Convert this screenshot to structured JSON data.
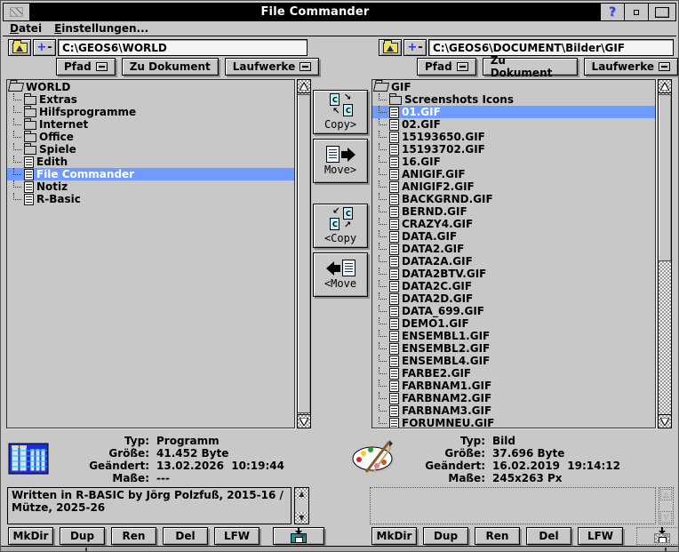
{
  "window": {
    "title": "File Commander",
    "help_label": "?"
  },
  "menu": {
    "items": [
      {
        "label": "Datei"
      },
      {
        "label": "Einstellungen..."
      }
    ]
  },
  "paths": {
    "left": "C:\\GEOS6\\WORLD",
    "right": "C:\\GEOS6\\DOCUMENT\\Bilder\\GIF"
  },
  "path_tools": {
    "plus": "+",
    "minus": "-"
  },
  "nav_buttons": {
    "pfad": "Pfad",
    "zu_dokument": "Zu Dokument",
    "laufwerke": "Laufwerke"
  },
  "transfer": {
    "copy_right": "Copy>",
    "move_right": "Move>",
    "copy_left": "<Copy",
    "move_left": "<Move"
  },
  "left_panel": {
    "root": "WORLD",
    "items": [
      {
        "label": "Extras",
        "type": "folder"
      },
      {
        "label": "Hilfsprogramme",
        "type": "folder"
      },
      {
        "label": "Internet",
        "type": "folder"
      },
      {
        "label": "Office",
        "type": "folder"
      },
      {
        "label": "Spiele",
        "type": "folder"
      },
      {
        "label": "Edith",
        "type": "file"
      },
      {
        "label": "File Commander",
        "type": "file",
        "selected": true
      },
      {
        "label": "Notiz",
        "type": "file"
      },
      {
        "label": "R-Basic",
        "type": "file"
      }
    ]
  },
  "right_panel": {
    "root": "GIF",
    "items": [
      {
        "label": "Screenshots Icons",
        "type": "folder"
      },
      {
        "label": "01.GIF",
        "type": "file",
        "selected": true
      },
      {
        "label": "02.GIF",
        "type": "file"
      },
      {
        "label": "15193650.GIF",
        "type": "file"
      },
      {
        "label": "15193702.GIF",
        "type": "file"
      },
      {
        "label": "16.GIF",
        "type": "file"
      },
      {
        "label": "ANIGIF.GIF",
        "type": "file"
      },
      {
        "label": "ANIGIF2.GIF",
        "type": "file"
      },
      {
        "label": "BACKGRND.GIF",
        "type": "file"
      },
      {
        "label": "BERND.GIF",
        "type": "file"
      },
      {
        "label": "CRAZY4.GIF",
        "type": "file"
      },
      {
        "label": "DATA.GIF",
        "type": "file"
      },
      {
        "label": "DATA2.GIF",
        "type": "file"
      },
      {
        "label": "DATA2A.GIF",
        "type": "file"
      },
      {
        "label": "DATA2BTV.GIF",
        "type": "file"
      },
      {
        "label": "DATA2C.GIF",
        "type": "file"
      },
      {
        "label": "DATA2D.GIF",
        "type": "file"
      },
      {
        "label": "DATA_699.GIF",
        "type": "file"
      },
      {
        "label": "DEMO1.GIF",
        "type": "file"
      },
      {
        "label": "ENSEMBL1.GIF",
        "type": "file"
      },
      {
        "label": "ENSEMBL2.GIF",
        "type": "file"
      },
      {
        "label": "ENSEMBL4.GIF",
        "type": "file"
      },
      {
        "label": "FARBE2.GIF",
        "type": "file"
      },
      {
        "label": "FARBNAM1.GIF",
        "type": "file"
      },
      {
        "label": "FARBNAM2.GIF",
        "type": "file"
      },
      {
        "label": "FARBNAM3.GIF",
        "type": "file"
      },
      {
        "label": "FORUMNEU.GIF",
        "type": "file"
      }
    ]
  },
  "left_info": {
    "labels": [
      "Typ:",
      "Größe:",
      "Geändert:",
      "Maße:"
    ],
    "values": [
      "Programm",
      "41.452 Byte",
      "13.02.2026  10:19:44",
      "---"
    ],
    "icon": "file-cabinet"
  },
  "right_info": {
    "labels": [
      "Typ:",
      "Größe:",
      "Geändert:",
      "Maße:"
    ],
    "values": [
      "Bild",
      "37.696 Byte",
      "16.02.2019  19:14:12",
      "245x263 Px"
    ],
    "icon": "palette"
  },
  "about_text": "Written in R-BASIC by Jörg Polzfuß, 2015-16 / Mütze, 2025-26",
  "file_buttons": [
    "MkDir",
    "Dup",
    "Ren",
    "Del",
    "LFW"
  ],
  "colors": {
    "selection": "#6f9bff",
    "titlebar": "#000000",
    "background": "#c8c8c8",
    "floppy_teal": "#009aa8",
    "help_blue": "#2f3bd6"
  }
}
